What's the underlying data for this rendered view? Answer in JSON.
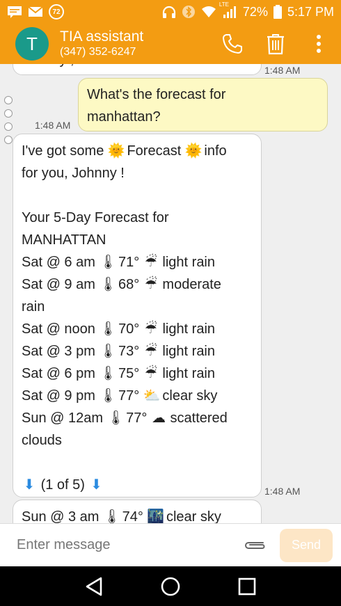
{
  "status_bar": {
    "battery": "72%",
    "time": "5:17 PM",
    "lte_label": "LTE",
    "notification_count": "72"
  },
  "app_bar": {
    "avatar_letter": "T",
    "title": "TIA assistant",
    "subtitle": "(347) 352-6247"
  },
  "messages": {
    "top_partial": "Johnny , or text HELP",
    "top_partial_time": "1:48 AM",
    "outgoing_line1": "What's the forecast for",
    "outgoing_line2": "manhattan?",
    "outgoing_time": "1:48 AM",
    "main_time": "1:48 AM",
    "main": {
      "l1_a": "I've got some",
      "l1_b": "Forecast",
      "l1_c": "info",
      "l2": "for you, Johnny !",
      "h1": "Your 5-Day Forecast for",
      "h2": "MANHATTAN",
      "rows": [
        {
          "when": "Sat @ 6 am",
          "temp": "71°",
          "cond": "light rain"
        },
        {
          "when": "Sat @ 9 am",
          "temp": "68°",
          "cond": "moderate"
        },
        {
          "when": "",
          "temp": "",
          "cond": "rain"
        },
        {
          "when": "Sat @ noon",
          "temp": "70°",
          "cond": "light rain"
        },
        {
          "when": "Sat @ 3 pm",
          "temp": "73°",
          "cond": "light rain"
        },
        {
          "when": "Sat @ 6 pm",
          "temp": "75°",
          "cond": "light rain"
        },
        {
          "when": "Sat @ 9 pm",
          "temp": "77°",
          "cond": "clear sky"
        },
        {
          "when": "Sun @ 12am",
          "temp": "77°",
          "cond": "scattered"
        },
        {
          "when": "",
          "temp": "",
          "cond": "clouds"
        }
      ],
      "pager": "(1 of 5)"
    },
    "bottom_partial": {
      "when": "Sun @ 3 am",
      "temp": "74°",
      "cond": "clear sky"
    }
  },
  "compose": {
    "placeholder": "Enter message",
    "send_label": "Send"
  },
  "colors": {
    "accent": "#f39c12",
    "avatar": "#1a9a8a",
    "outgoing_bubble": "#fdf9c4"
  }
}
